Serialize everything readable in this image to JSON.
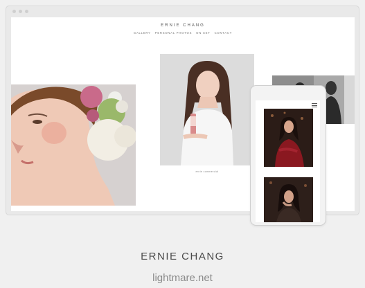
{
  "site": {
    "title": "ERNIE CHANG",
    "nav": [
      "GALLERY",
      "PERSONAL PHOTOS",
      "ON SET",
      "CONTACT"
    ],
    "center_caption": "ernie commercial"
  },
  "footer": {
    "title": "ERNIE CHANG",
    "url": "lightmare.net"
  },
  "icons": {
    "window_dots": "traffic-light-dots",
    "mobile_menu": "hamburger-menu-icon"
  },
  "colors": {
    "page_bg": "#f0f0f0",
    "viewport_bg": "#ffffff",
    "footer_text": "#4a4a4a",
    "footer_url": "#8a8a8a"
  }
}
